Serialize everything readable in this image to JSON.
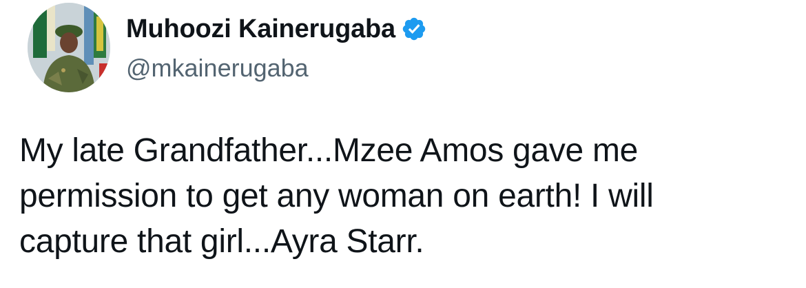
{
  "author": {
    "display_name": "Muhoozi Kainerugaba",
    "handle": "@mkainerugaba",
    "verified": true,
    "avatar": "profile-photo-icon"
  },
  "tweet": {
    "lines": [
      "My late Grandfather...Mzee Amos gave me",
      "permission to get any woman on earth! I will",
      "capture that girl...Ayra Starr."
    ]
  },
  "colors": {
    "text": "#0f1419",
    "secondary_text": "#536471",
    "verified_badge": "#1d9bf0",
    "background": "#ffffff"
  }
}
